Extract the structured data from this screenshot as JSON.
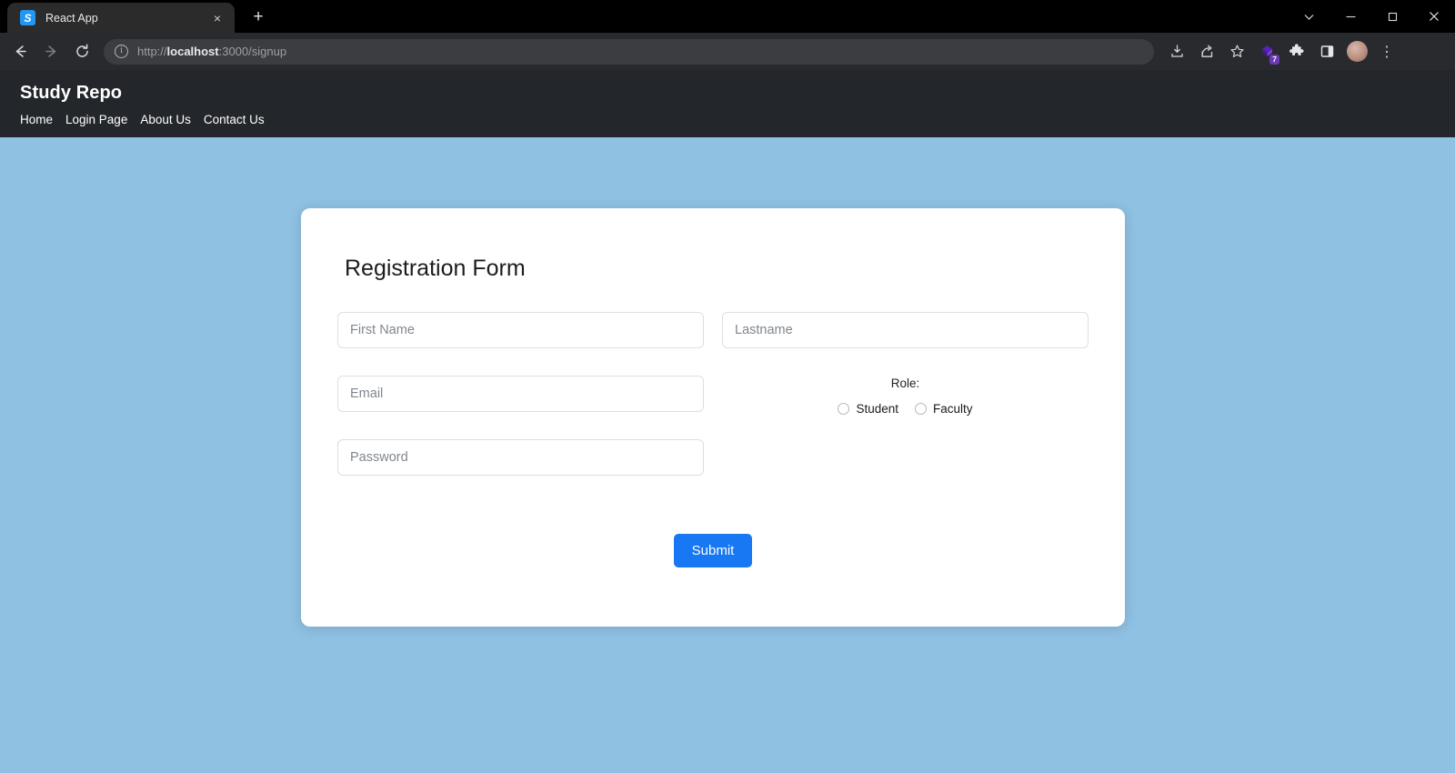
{
  "browser": {
    "tab": {
      "favicon_letter": "S",
      "title": "React App",
      "close_label": "×"
    },
    "new_tab_label": "+",
    "window_controls": {
      "chevron": "⌄",
      "minimize": "—",
      "maximize": "☐",
      "close": "✕"
    },
    "nav": {
      "back": "←",
      "forward": "→",
      "reload": "⟳"
    },
    "omnibox": {
      "info_icon": "i",
      "scheme": "http://",
      "host": "localhost",
      "rest": ":3000/signup",
      "full_url": "http://localhost:3000/signup"
    },
    "toolbar_icons": {
      "download": "download-icon",
      "share": "share-icon",
      "bookmark": "star-icon",
      "extension_purple": "purple-extension-icon",
      "extension_badge_count": "7",
      "extensions": "puzzle-icon",
      "side_panel": "side-panel-icon",
      "profile": "avatar",
      "menu": "⋮"
    }
  },
  "site": {
    "brand": "Study Repo",
    "nav_links": [
      {
        "label": "Home"
      },
      {
        "label": "Login Page"
      },
      {
        "label": "About Us"
      },
      {
        "label": "Contact Us"
      }
    ]
  },
  "form": {
    "title": "Registration Form",
    "fields": {
      "first_name": {
        "placeholder": "First Name",
        "value": ""
      },
      "last_name": {
        "placeholder": "Lastname",
        "value": ""
      },
      "email": {
        "placeholder": "Email",
        "value": ""
      },
      "password": {
        "placeholder": "Password",
        "value": ""
      }
    },
    "role": {
      "label": "Role:",
      "options": [
        {
          "label": "Student",
          "checked": false
        },
        {
          "label": "Faculty",
          "checked": false
        }
      ]
    },
    "submit_label": "Submit"
  },
  "colors": {
    "page_background": "#8fc1e3",
    "navbar": "#23262b",
    "card": "#ffffff",
    "accent_button": "#1877f2",
    "browser_toolbar": "#292a2d"
  }
}
